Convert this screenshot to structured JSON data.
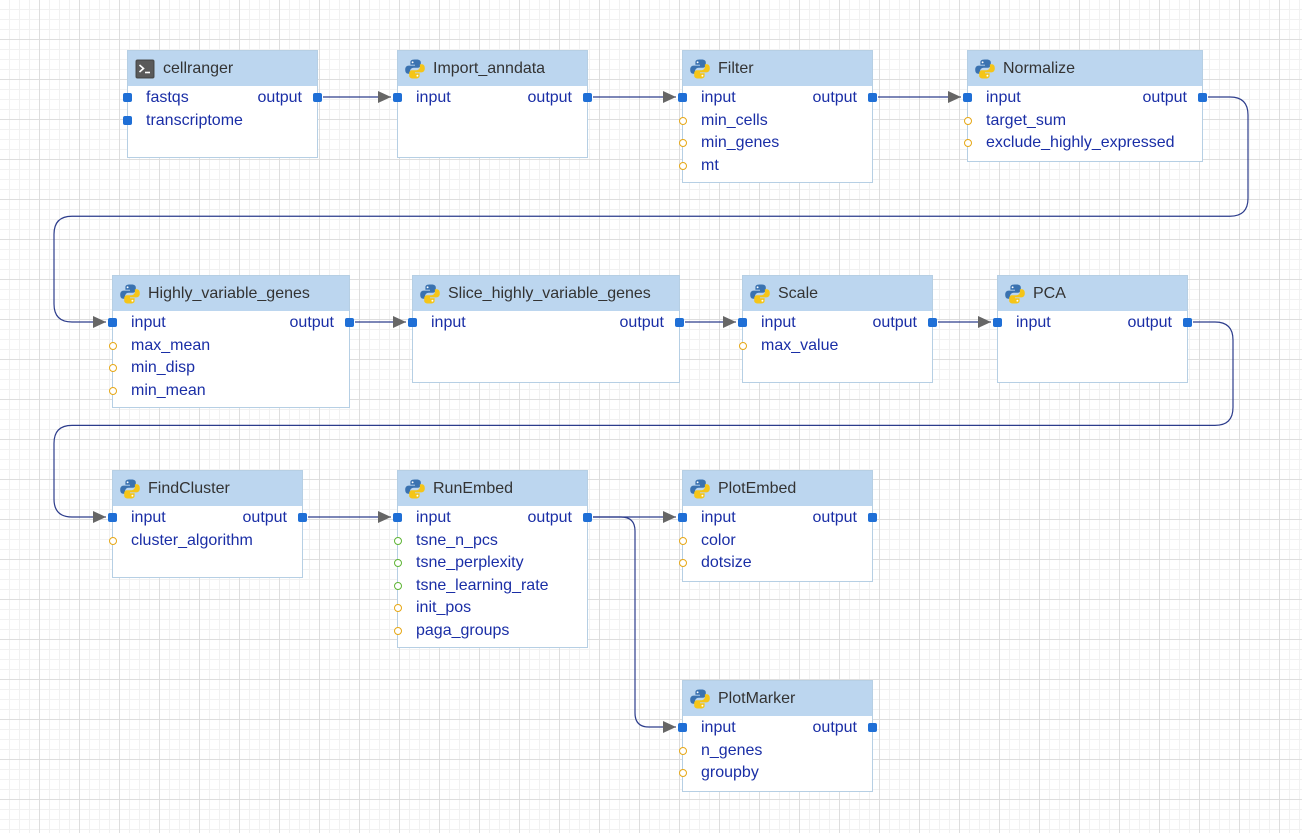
{
  "nodes": [
    {
      "id": "cellranger",
      "title": "cellranger",
      "icon": "terminal-icon",
      "output": "output",
      "inputs": [
        {
          "label": "fastqs",
          "kind": "input"
        },
        {
          "label": "transcriptome",
          "kind": "input"
        }
      ]
    },
    {
      "id": "import_anndata",
      "title": "Import_anndata",
      "icon": "python-icon",
      "output": "output",
      "inputs": [
        {
          "label": "input",
          "kind": "input"
        }
      ]
    },
    {
      "id": "filter",
      "title": "Filter",
      "icon": "python-icon",
      "output": "output",
      "inputs": [
        {
          "label": "input",
          "kind": "input"
        },
        {
          "label": "min_cells",
          "kind": "param"
        },
        {
          "label": "min_genes",
          "kind": "param"
        },
        {
          "label": "mt",
          "kind": "param"
        }
      ]
    },
    {
      "id": "normalize",
      "title": "Normalize",
      "icon": "python-icon",
      "output": "output",
      "inputs": [
        {
          "label": "input",
          "kind": "input"
        },
        {
          "label": "target_sum",
          "kind": "param"
        },
        {
          "label": "exclude_highly_expressed",
          "kind": "param"
        }
      ]
    },
    {
      "id": "highly_variable_genes",
      "title": "Highly_variable_genes",
      "icon": "python-icon",
      "output": "output",
      "inputs": [
        {
          "label": "input",
          "kind": "input"
        },
        {
          "label": "max_mean",
          "kind": "param"
        },
        {
          "label": "min_disp",
          "kind": "param"
        },
        {
          "label": "min_mean",
          "kind": "param"
        }
      ]
    },
    {
      "id": "slice_hvg",
      "title": "Slice_highly_variable_genes",
      "icon": "python-icon",
      "output": "output",
      "inputs": [
        {
          "label": "input",
          "kind": "input"
        }
      ]
    },
    {
      "id": "scale",
      "title": "Scale",
      "icon": "python-icon",
      "output": "output",
      "inputs": [
        {
          "label": "input",
          "kind": "input"
        },
        {
          "label": "max_value",
          "kind": "param"
        }
      ]
    },
    {
      "id": "pca",
      "title": "PCA",
      "icon": "python-icon",
      "output": "output",
      "inputs": [
        {
          "label": "input",
          "kind": "input"
        }
      ]
    },
    {
      "id": "findcluster",
      "title": "FindCluster",
      "icon": "python-icon",
      "output": "output",
      "inputs": [
        {
          "label": "input",
          "kind": "input"
        },
        {
          "label": "cluster_algorithm",
          "kind": "param"
        }
      ]
    },
    {
      "id": "runembed",
      "title": "RunEmbed",
      "icon": "python-icon",
      "output": "output",
      "inputs": [
        {
          "label": "input",
          "kind": "input"
        },
        {
          "label": "tsne_n_pcs",
          "kind": "param-green"
        },
        {
          "label": "tsne_perplexity",
          "kind": "param-green"
        },
        {
          "label": "tsne_learning_rate",
          "kind": "param-green"
        },
        {
          "label": "init_pos",
          "kind": "param"
        },
        {
          "label": "paga_groups",
          "kind": "param"
        }
      ]
    },
    {
      "id": "plotembed",
      "title": "PlotEmbed",
      "icon": "python-icon",
      "output": "output",
      "inputs": [
        {
          "label": "input",
          "kind": "input"
        },
        {
          "label": "color",
          "kind": "param"
        },
        {
          "label": "dotsize",
          "kind": "param"
        }
      ]
    },
    {
      "id": "plotmarker",
      "title": "PlotMarker",
      "icon": "python-icon",
      "output": "output",
      "inputs": [
        {
          "label": "input",
          "kind": "input"
        },
        {
          "label": "n_genes",
          "kind": "param"
        },
        {
          "label": "groupby",
          "kind": "param"
        }
      ]
    }
  ],
  "edges": [
    [
      "cellranger",
      "import_anndata"
    ],
    [
      "import_anndata",
      "filter"
    ],
    [
      "filter",
      "normalize"
    ],
    [
      "normalize",
      "highly_variable_genes"
    ],
    [
      "highly_variable_genes",
      "slice_hvg"
    ],
    [
      "slice_hvg",
      "scale"
    ],
    [
      "scale",
      "pca"
    ],
    [
      "pca",
      "findcluster"
    ],
    [
      "findcluster",
      "runembed"
    ],
    [
      "runembed",
      "plotembed"
    ],
    [
      "runembed",
      "plotmarker"
    ]
  ],
  "colors": {
    "header": "#bcd6ef",
    "border": "#b6cfe4",
    "port": "#1f6fd6",
    "param_port": "#e6a817",
    "param_port_green": "#5fb536",
    "label": "#1a2ea6",
    "wire": "#2d3d8c",
    "arrow": "#666666"
  }
}
